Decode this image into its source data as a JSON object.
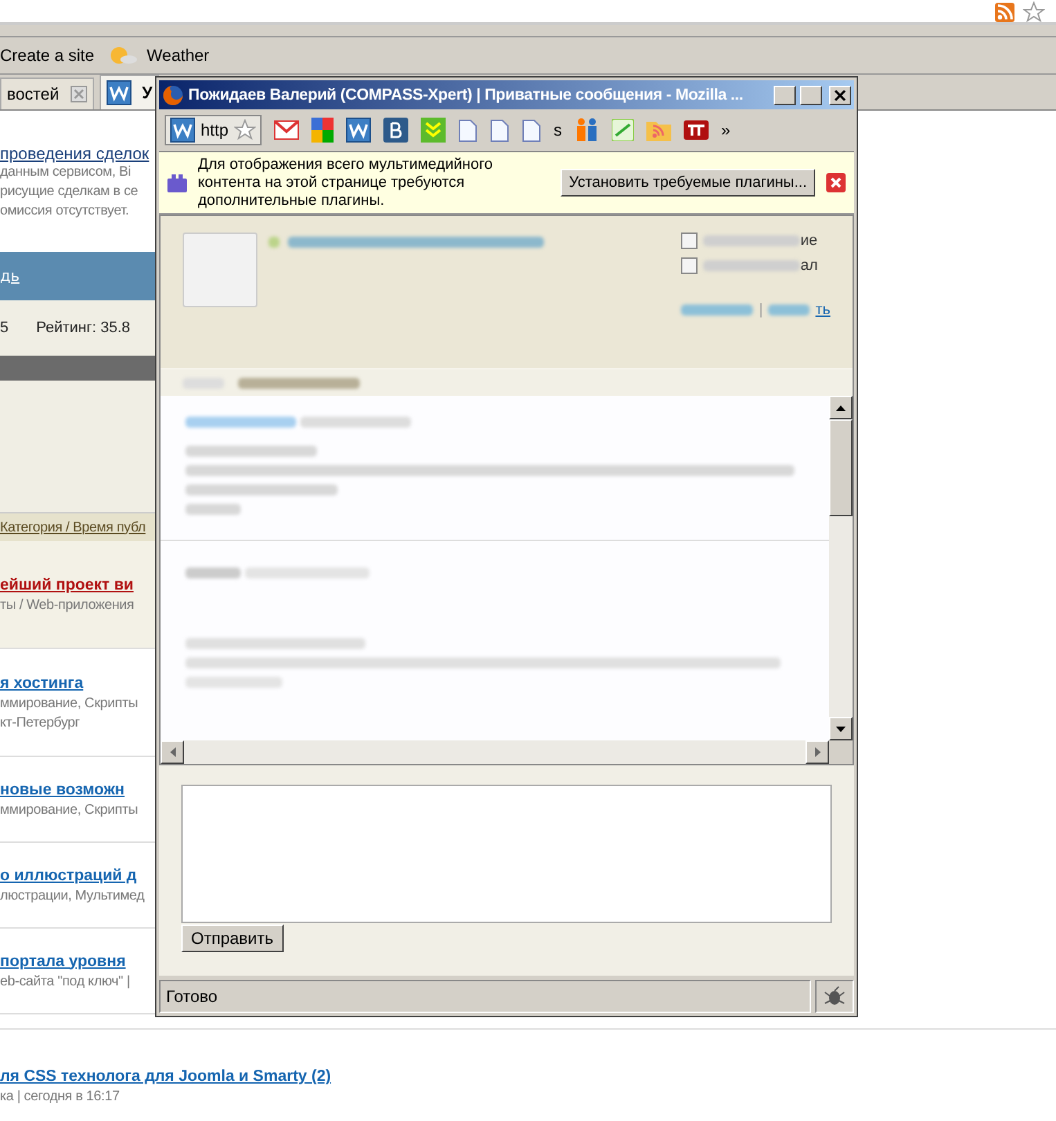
{
  "browser": {
    "bookmarks": [
      {
        "label": "Create a site",
        "kind": "plain"
      },
      {
        "label": "Weather",
        "kind": "weather"
      }
    ],
    "tabs": [
      {
        "label": "востей",
        "selected": false,
        "closable": true
      },
      {
        "label": "У",
        "selected": true,
        "closable": false
      }
    ]
  },
  "page": {
    "intro_link": "проведения сделок",
    "intro_lines": [
      "данным сервисом, Ві",
      "рисущие сделкам в се",
      "омиссия отсутствует."
    ],
    "nav_link": "дь",
    "stats": [
      "5",
      "Рейтинг: 35.8"
    ],
    "list_header": "Категория / Время публ",
    "items": [
      {
        "title": "ейший проект ви",
        "meta": [
          "ты / Web-приложения"
        ],
        "highlighted": true
      },
      {
        "title": "я хостинга",
        "meta": [
          "ммирование, Скрипты",
          "кт-Петербург"
        ],
        "highlighted": false
      },
      {
        "title": " новые возможн",
        "meta": [
          "ммирование, Скрипты"
        ],
        "highlighted": false
      },
      {
        "title": "о иллюстраций д",
        "meta": [
          "люстрации, Мультимед"
        ],
        "highlighted": false
      },
      {
        "title": " портала уровня",
        "meta": [
          "eb-сайта \"под ключ\" |"
        ],
        "highlighted": false
      }
    ],
    "bottom_item": {
      "title": "ля CSS технолога для Joomla и Smarty (2)",
      "meta": "ка | сегодня в 16:17"
    }
  },
  "popup": {
    "title": "Пожидаев Валерий (COMPASS-Xpert) | Приватные сообщения - Mozilla ...",
    "address": "http",
    "toolbar_text": "s",
    "overflow": "»",
    "plugin_bar": {
      "lines": [
        "Для отображения всего мультимедийного",
        "контента на этой странице требуются",
        "дополнительные плагины."
      ],
      "button": "Установить требуемые плагины..."
    },
    "options": [
      {
        "label_tail": "ие",
        "checked": false
      },
      {
        "label_tail": "ал",
        "checked": false
      }
    ],
    "action_separator": "|",
    "action_tail": "ть",
    "send_button": "Отправить",
    "status": "Готово"
  }
}
